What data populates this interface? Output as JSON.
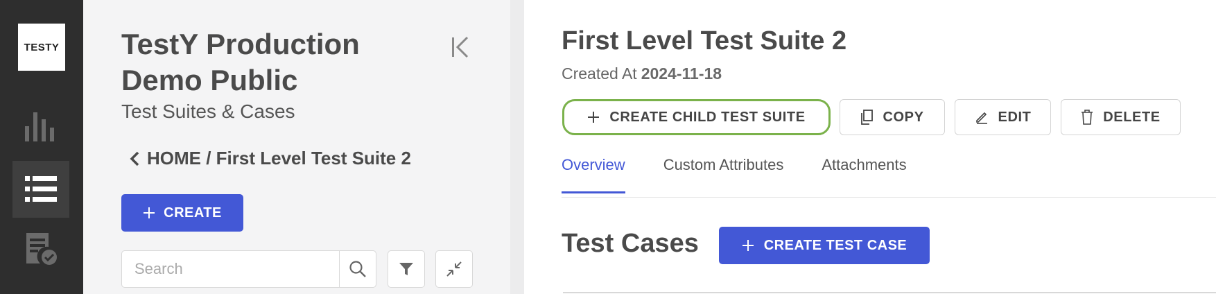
{
  "rail": {
    "logo_text": "TESTY",
    "items": [
      "analytics-icon",
      "list-icon",
      "test-plan-icon"
    ]
  },
  "tree": {
    "project_title": "TestY Production Demo Public",
    "subtitle": "Test Suites & Cases",
    "breadcrumb": "HOME / First Level Test Suite 2",
    "create_label": "CREATE",
    "search_placeholder": "Search"
  },
  "main": {
    "title": "First Level Test Suite 2",
    "created_label": "Created At",
    "created_date": "2024-11-18",
    "actions": {
      "create_child": "CREATE CHILD TEST SUITE",
      "copy": "COPY",
      "edit": "EDIT",
      "delete": "DELETE"
    },
    "tabs": [
      "Overview",
      "Custom Attributes",
      "Attachments"
    ],
    "test_cases_title": "Test Cases",
    "create_test_case": "CREATE TEST CASE"
  },
  "colors": {
    "accent": "#4358d6",
    "rail": "#2e2e2e",
    "highlight": "#7bb24b"
  }
}
